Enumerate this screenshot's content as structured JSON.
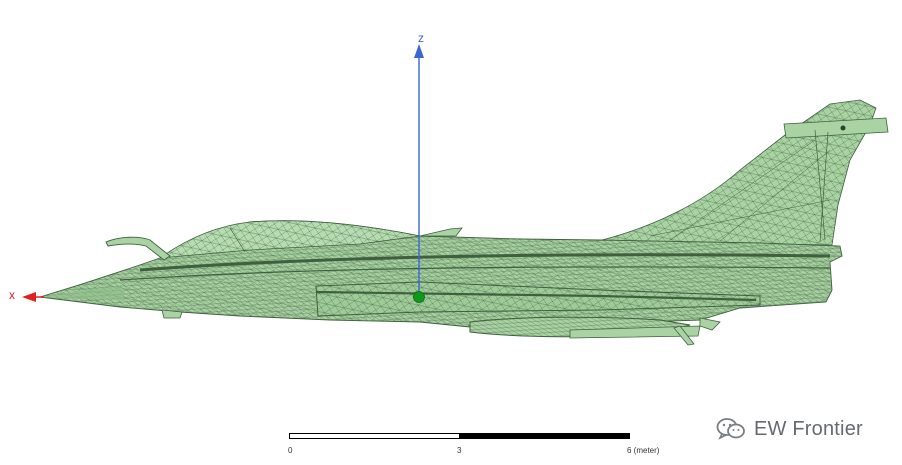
{
  "axes": {
    "z_label": "z",
    "x_label": "x",
    "z_color": "#3a66d6",
    "x_color": "#e02020"
  },
  "model": {
    "fill_color": "#a9d3a3",
    "mesh_color": "#3f5f3f",
    "center_marker_color": "#0c9a18"
  },
  "scale_bar": {
    "ticks": [
      "0",
      "3",
      "6 (meter)"
    ]
  },
  "watermark": {
    "text": "EW Frontier",
    "icon": "wechat-icon"
  }
}
